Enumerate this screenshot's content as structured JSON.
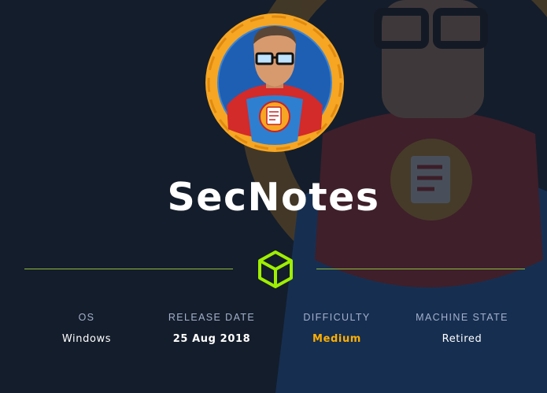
{
  "machine": {
    "name": "SecNotes",
    "avatar_icon": "superhero-notepad-avatar",
    "divider_icon": "cube-icon"
  },
  "stats": [
    {
      "label": "OS",
      "value": "Windows"
    },
    {
      "label": "RELEASE DATE",
      "value": "25 Aug 2018"
    },
    {
      "label": "DIFFICULTY",
      "value": "Medium"
    },
    {
      "label": "MACHINE STATE",
      "value": "Retired"
    }
  ],
  "colors": {
    "background": "#141d2b",
    "accent_green": "#9fef00",
    "difficulty_medium": "#ffaf00",
    "label_gray": "#a4b1cd",
    "avatar_ring": "#f6a623"
  }
}
